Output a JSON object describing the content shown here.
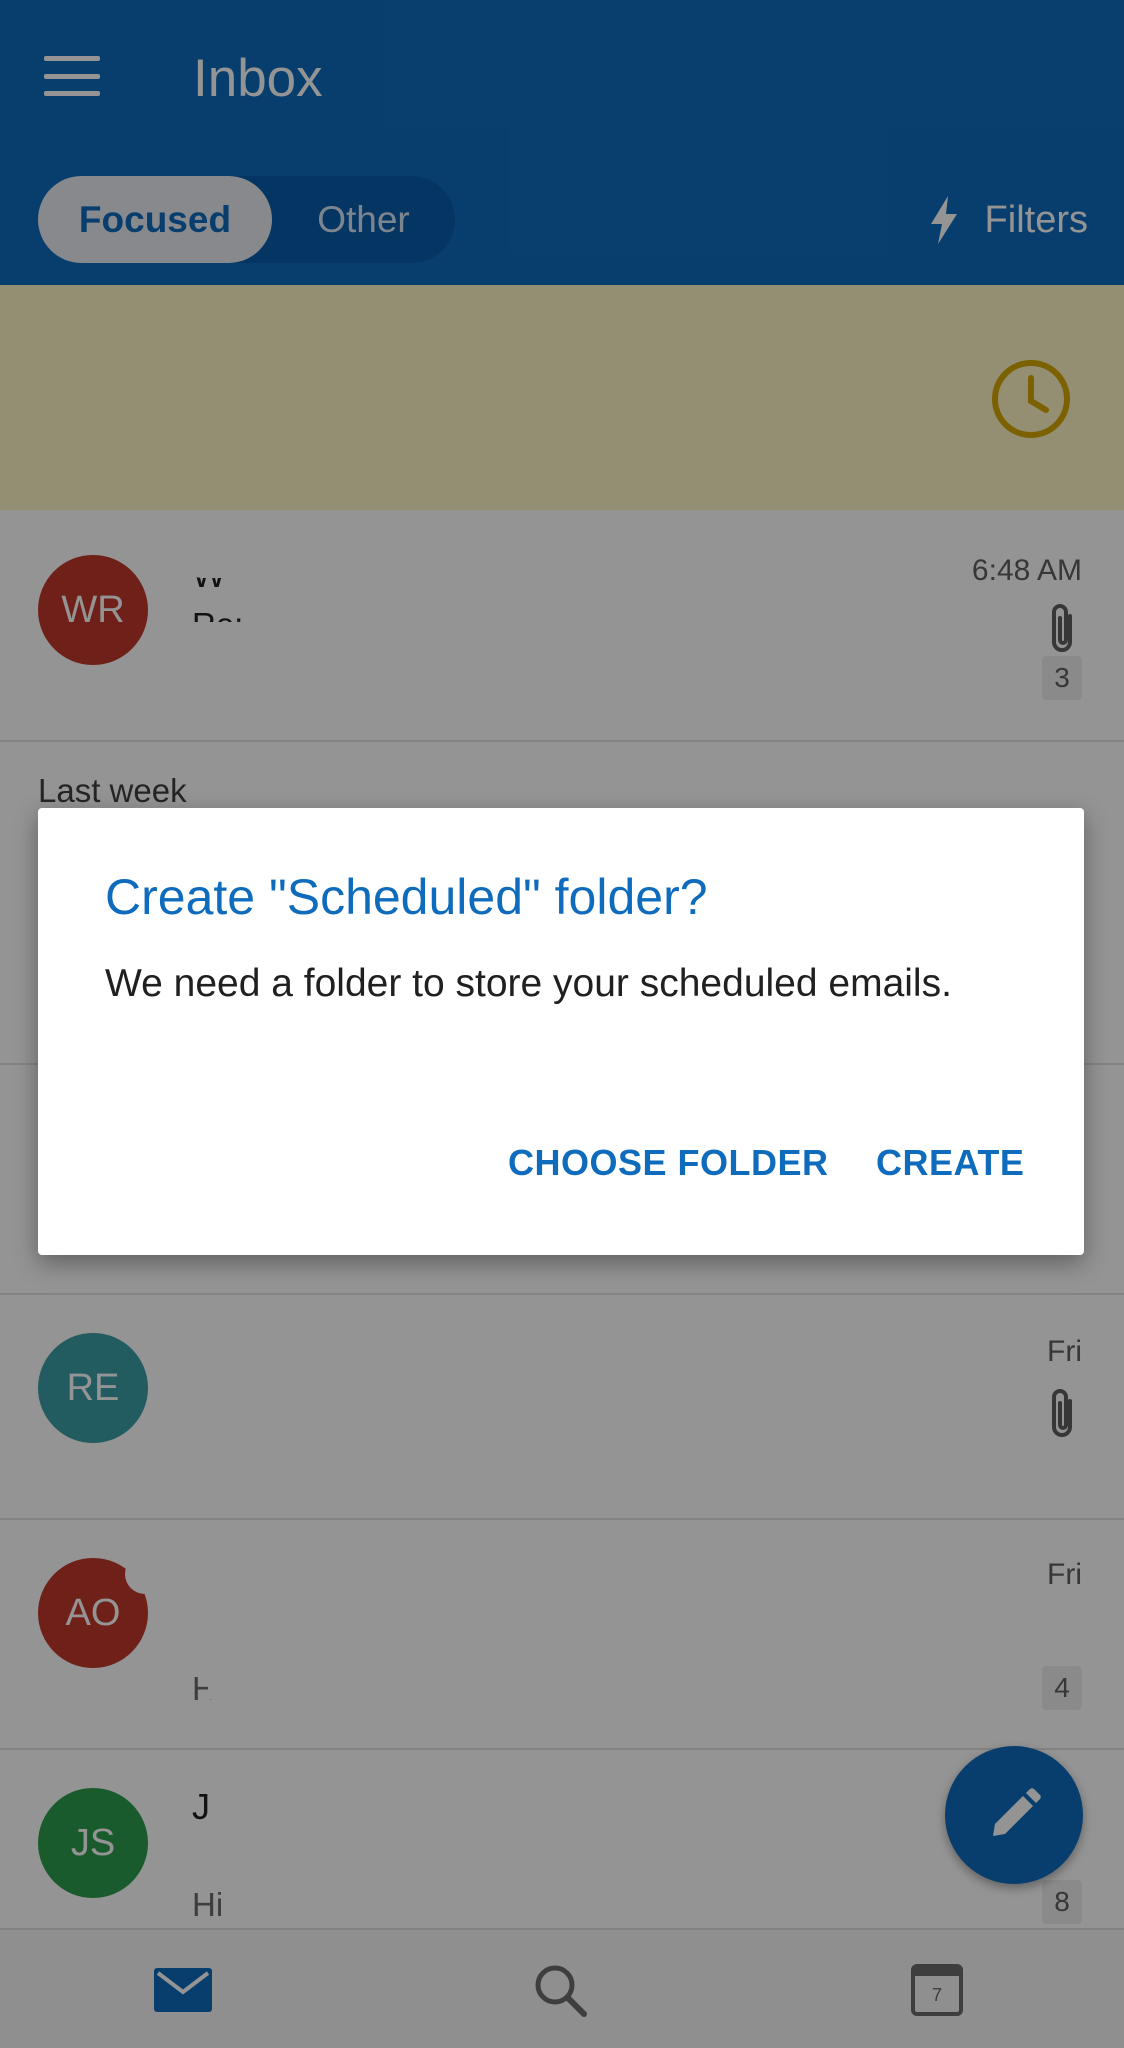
{
  "header": {
    "title": "Inbox",
    "tabs": [
      {
        "label": "Focused",
        "selected": true
      },
      {
        "label": "Other",
        "selected": false
      }
    ],
    "filters_label": "Filters"
  },
  "emails_top": [
    {
      "initials": "WR",
      "avatar_color": "#c0392b",
      "sender": "W",
      "subject": "Re:",
      "preview": "",
      "time": "6:48 AM",
      "attachment": true,
      "count": "3"
    }
  ],
  "section": {
    "label": "Last week"
  },
  "emails_bottom": [
    {
      "initials": "RE",
      "avatar_color": "#3b9ea6",
      "sender": "",
      "subject": "",
      "preview": "",
      "time": "Fri",
      "attachment": true,
      "count": ""
    },
    {
      "initials": "AO",
      "avatar_color": "#c0392b",
      "sender": "",
      "subject": "",
      "preview": "H",
      "time": "Fri",
      "attachment": false,
      "count": "4"
    },
    {
      "initials": "JS",
      "avatar_color": "#2e9d4f",
      "sender": "J",
      "subject": "",
      "preview": "Hi",
      "time": "",
      "attachment": false,
      "count": "8"
    }
  ],
  "dialog": {
    "title": "Create \"Scheduled\" folder?",
    "body": "We need a folder to store your scheduled emails.",
    "choose_label": "CHOOSE FOLDER",
    "create_label": "CREATE"
  },
  "bottom_nav": {
    "calendar_day": "7"
  },
  "colors": {
    "brand": "#0f6cbd",
    "banner": "#fff4c7",
    "clock": "#d4a800"
  }
}
